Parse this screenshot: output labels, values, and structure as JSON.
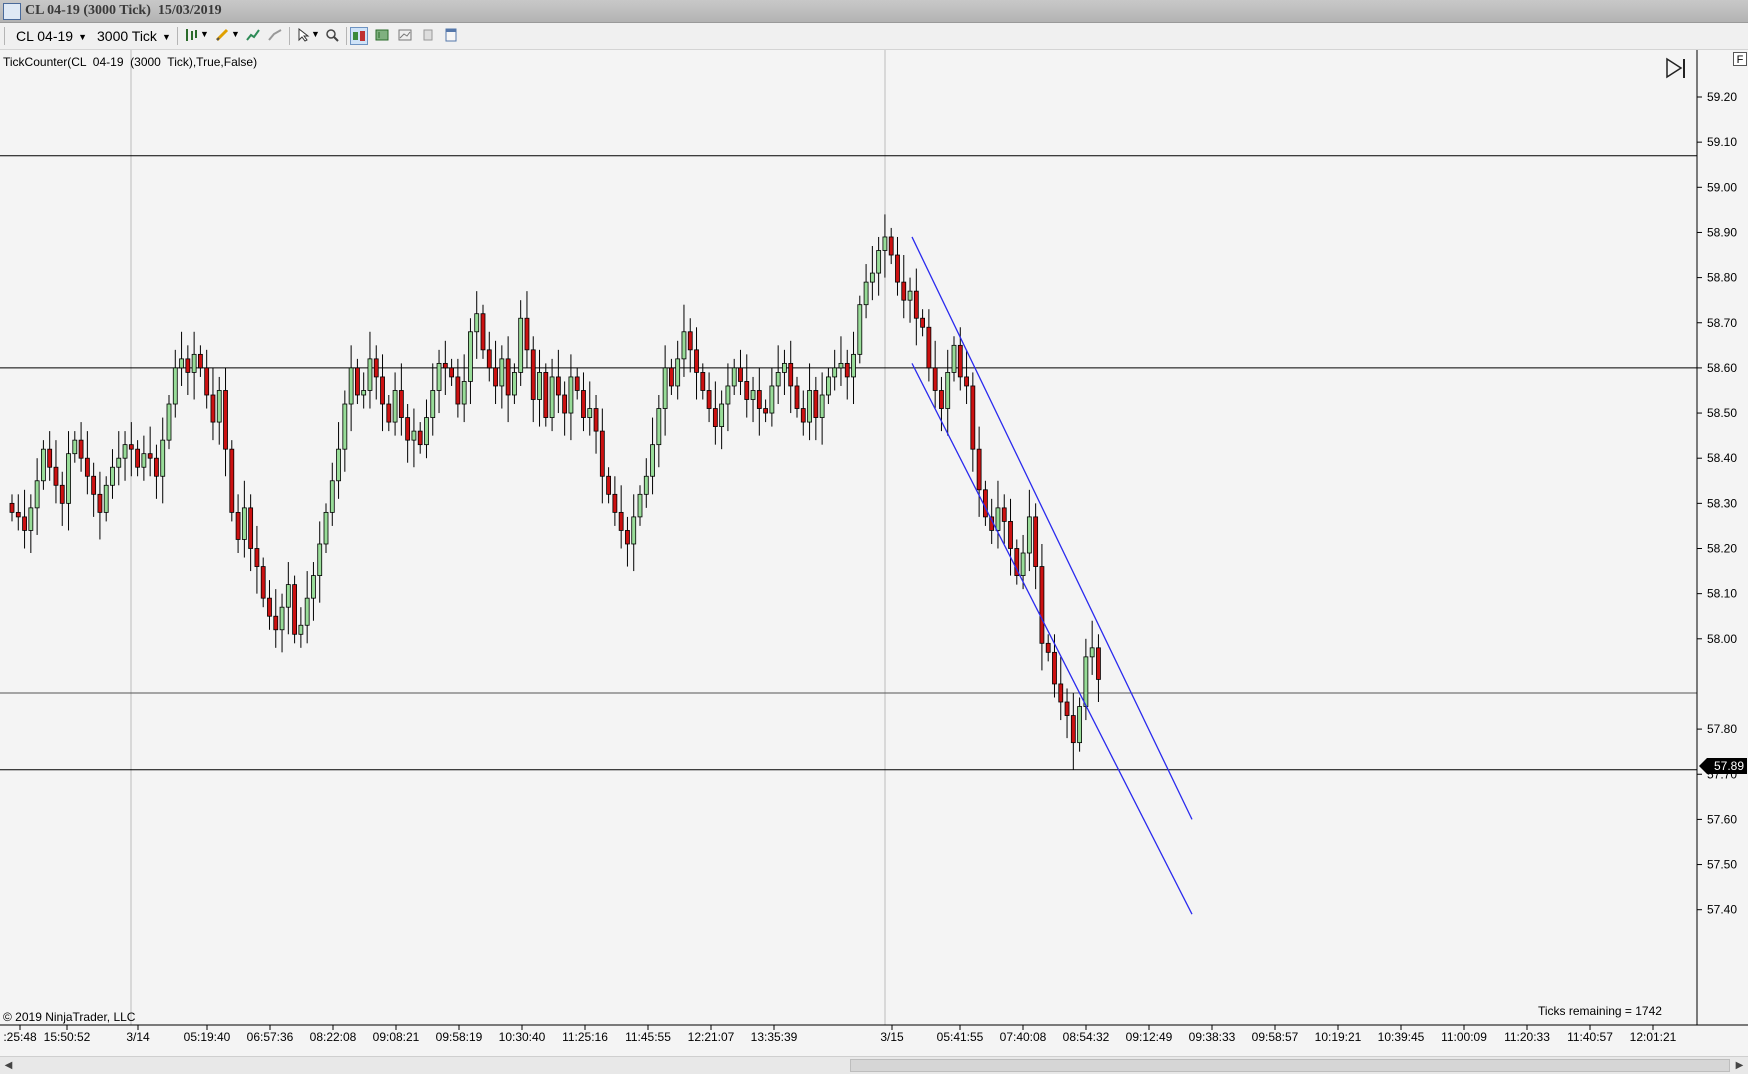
{
  "window": {
    "title": "CL 04-19 (3000 Tick)  15/03/2019"
  },
  "toolbar": {
    "instrument": "CL 04-19",
    "interval": "3000 Tick",
    "buttons": [
      {
        "icon": "bar-type-icon",
        "has_dropdown": true
      },
      {
        "icon": "drawing-pencil-icon",
        "has_dropdown": true
      },
      {
        "icon": "add-indicator-icon"
      },
      {
        "icon": "strategies-icon"
      },
      {
        "icon": "cursor-pointer-icon",
        "has_dropdown": true
      },
      {
        "icon": "zoom-icon"
      },
      {
        "icon": "chart-trader-icon",
        "active": true
      },
      {
        "icon": "data-box-icon"
      },
      {
        "icon": "chart-properties-icon"
      },
      {
        "icon": "snapshot-icon"
      },
      {
        "icon": "show-scroll-icon"
      }
    ]
  },
  "chart": {
    "indicator_label": "TickCounter(CL  04-19  (3000  Tick),True,False)",
    "copyright": "© 2019 NinjaTrader, LLC",
    "ticks_remaining": "Ticks remaining = 1742",
    "last_price": "57.89",
    "corner_label": "F",
    "colors": {
      "up_candle": "#98dc98",
      "down_candle": "#cc1111",
      "wick": "#000000",
      "trend_channel": "#2a2aee",
      "background": "#f4f4f4"
    }
  },
  "chart_data": {
    "type": "candlestick",
    "y_axis_labels": [
      "59.20",
      "59.10",
      "59.00",
      "58.90",
      "58.80",
      "58.70",
      "58.60",
      "58.50",
      "58.40",
      "58.30",
      "58.20",
      "58.10",
      "58.00",
      "57.80",
      "57.70",
      "57.60",
      "57.50",
      "57.40"
    ],
    "ylim": [
      57.38,
      59.24
    ],
    "x_axis_labels": [
      ":25:48",
      "15:50:52",
      "3/14",
      "05:19:40",
      "06:57:36",
      "08:22:08",
      "09:08:21",
      "09:58:19",
      "10:30:40",
      "11:25:16",
      "11:45:55",
      "12:21:07",
      "13:35:39",
      "3/15",
      "05:41:55",
      "07:40:08",
      "08:54:32",
      "09:12:49",
      "09:38:33",
      "09:58:57",
      "10:19:21",
      "10:39:45",
      "11:00:09",
      "11:20:33",
      "11:40:57",
      "12:01:21"
    ],
    "session_breaks": [
      "3/14",
      "3/15"
    ],
    "horizontal_lines": [
      59.07,
      58.6,
      57.88,
      57.71
    ],
    "channel_lines": [
      {
        "from": [
          "05:41:55",
          58.89
        ],
        "to": [
          "09:38:33",
          57.6
        ]
      },
      {
        "from": [
          "05:41:55",
          58.61
        ],
        "to": [
          "09:38:33",
          57.39
        ]
      }
    ],
    "closes": [
      58.28,
      58.27,
      58.24,
      58.29,
      58.35,
      58.42,
      58.38,
      58.34,
      58.3,
      58.41,
      58.44,
      58.4,
      58.36,
      58.32,
      58.28,
      58.34,
      58.38,
      58.4,
      58.43,
      58.42,
      58.38,
      58.41,
      58.4,
      58.36,
      58.44,
      58.52,
      58.6,
      58.62,
      58.59,
      58.63,
      58.6,
      58.54,
      58.48,
      58.55,
      58.42,
      58.28,
      58.22,
      58.29,
      58.2,
      58.16,
      58.09,
      58.05,
      58.02,
      58.07,
      58.12,
      58.01,
      58.03,
      58.09,
      58.14,
      58.21,
      58.28,
      58.35,
      58.42,
      58.52,
      58.6,
      58.54,
      58.55,
      58.62,
      58.58,
      58.52,
      58.48,
      58.55,
      58.49,
      58.44,
      58.46,
      58.43,
      58.49,
      58.55,
      58.61,
      58.6,
      58.58,
      58.52,
      58.57,
      58.68,
      58.72,
      58.64,
      58.6,
      58.56,
      58.62,
      58.54,
      58.59,
      58.71,
      58.64,
      58.53,
      58.59,
      58.49,
      58.58,
      58.54,
      58.5,
      58.58,
      58.55,
      58.49,
      58.51,
      58.46,
      58.36,
      58.32,
      58.28,
      58.24,
      58.21,
      58.27,
      58.32,
      58.36,
      58.43,
      58.51,
      58.6,
      58.56,
      58.62,
      58.68,
      58.64,
      58.59,
      58.55,
      58.51,
      58.47,
      58.52,
      58.56,
      58.6,
      58.57,
      58.53,
      58.55,
      58.51,
      58.5,
      58.56,
      58.59,
      58.61,
      58.56,
      58.51,
      58.48,
      58.55,
      58.49,
      58.54,
      58.58,
      58.6,
      58.61,
      58.58,
      58.63,
      58.74,
      58.79,
      58.81,
      58.86,
      58.89,
      58.85,
      58.79,
      58.75,
      58.77,
      58.71,
      58.69,
      58.6,
      58.55,
      58.51,
      58.59,
      58.65,
      58.58,
      58.56,
      58.42,
      58.33,
      58.27,
      58.24,
      58.29,
      58.26,
      58.2,
      58.14,
      58.19,
      58.27,
      58.16,
      57.99,
      57.97,
      57.9,
      57.86,
      57.83,
      57.77,
      57.85,
      57.96,
      57.98,
      57.91
    ]
  }
}
